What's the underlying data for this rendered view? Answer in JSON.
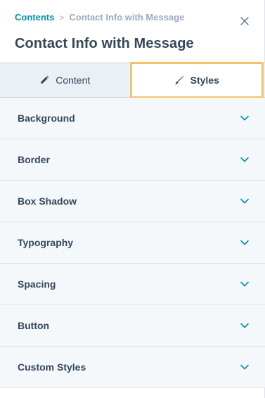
{
  "breadcrumb": {
    "root": "Contents",
    "separator": ">",
    "current": "Contact Info with Message"
  },
  "header": {
    "title": "Contact Info with Message",
    "close_icon": "close-icon"
  },
  "tabs": [
    {
      "label": "Content",
      "icon": "pencil-icon",
      "active": false
    },
    {
      "label": "Styles",
      "icon": "brush-icon",
      "active": true
    }
  ],
  "sections": [
    {
      "label": "Background"
    },
    {
      "label": "Border"
    },
    {
      "label": "Box Shadow"
    },
    {
      "label": "Typography"
    },
    {
      "label": "Spacing"
    },
    {
      "label": "Button"
    },
    {
      "label": "Custom Styles"
    }
  ],
  "colors": {
    "link": "#0091ae",
    "text": "#33475b",
    "muted": "#99acc2",
    "tab_bg": "#eaf0f6",
    "section_bg": "#f5f8fa",
    "highlight": "#f5c26b",
    "chevron": "#0091ae"
  }
}
